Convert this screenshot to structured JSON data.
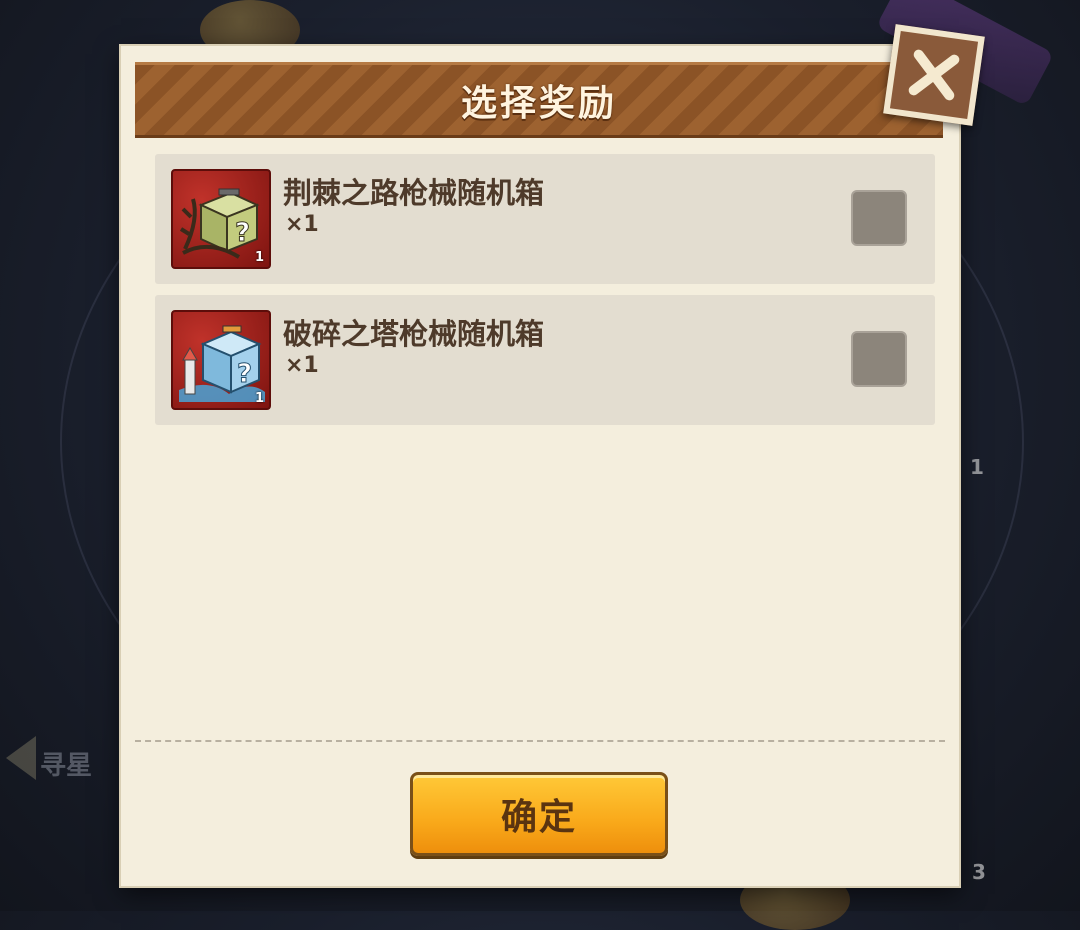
{
  "dialog": {
    "title": "选择奖励",
    "close_icon": "close-x-icon",
    "items": [
      {
        "name": "荆棘之路枪械随机箱",
        "quantity": "×1",
        "badge": "1",
        "icon": "thorn-mystery-box-icon",
        "checked": false
      },
      {
        "name": "破碎之塔枪械随机箱",
        "quantity": "×1",
        "badge": "1",
        "icon": "tower-mystery-box-icon",
        "checked": false
      }
    ],
    "confirm_label": "确定"
  },
  "background": {
    "side_label": "寻星",
    "badge_right": "1",
    "badge_bottom": "3"
  },
  "colors": {
    "panel": "#f4eedd",
    "header": "#8b5326",
    "button": "#f9a91a",
    "item_bg": "#e3ddd0",
    "text": "#4e3a2a"
  }
}
